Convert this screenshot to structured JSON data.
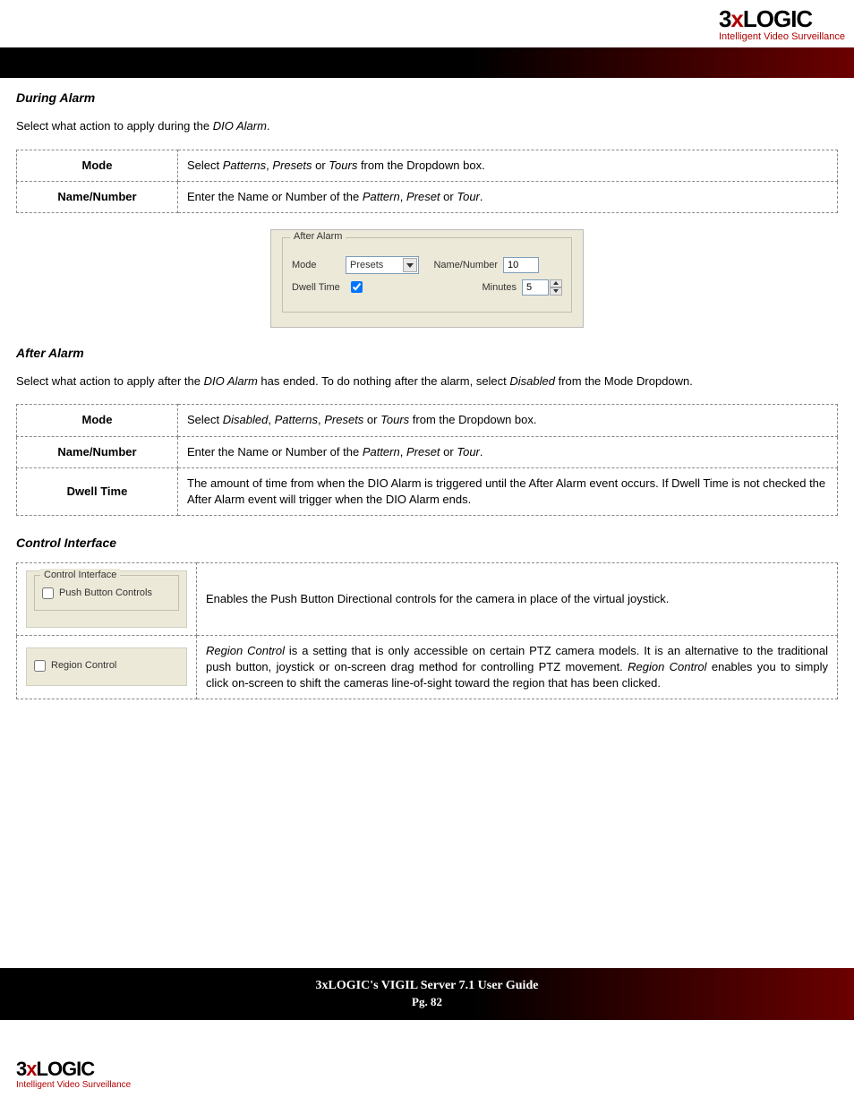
{
  "logo": {
    "text_prefix": "3",
    "text_mid": "x",
    "text_suffix": "LOGIC",
    "tag": "Intelligent Video Surveillance"
  },
  "sections": {
    "during_alarm": {
      "title": "During Alarm",
      "intro_pre": "Select what action to apply during the ",
      "intro_ital": "DIO Alarm",
      "intro_post": ".",
      "rows": {
        "mode_label": "Mode",
        "mode_desc_pre": "Select ",
        "mode_desc_i1": "Patterns",
        "mode_desc_m1": ", ",
        "mode_desc_i2": "Presets",
        "mode_desc_m2": " or ",
        "mode_desc_i3": "Tours",
        "mode_desc_post": " from the Dropdown box.",
        "nn_label": "Name/Number",
        "nn_desc_pre": "Enter the Name or Number of the ",
        "nn_desc_i1": "Pattern",
        "nn_desc_m1": ", ",
        "nn_desc_i2": "Preset",
        "nn_desc_m2": " or ",
        "nn_desc_i3": "Tour",
        "nn_desc_post": "."
      }
    },
    "mock": {
      "fieldset_title": "After Alarm",
      "mode_label": "Mode",
      "mode_value": "Presets",
      "nn_label": "Name/Number",
      "nn_value": "10",
      "dwell_label": "Dwell Time",
      "dwell_checked": true,
      "minutes_label": "Minutes",
      "minutes_value": "5"
    },
    "after_alarm": {
      "title": "After Alarm",
      "intro_pre": "Select what action to apply after the ",
      "intro_i1": "DIO Alarm",
      "intro_m1": " has ended.  To do nothing after the alarm, select ",
      "intro_i2": "Disabled",
      "intro_post": " from the Mode Dropdown.",
      "rows": {
        "mode_label": "Mode",
        "mode_desc_pre": "Select ",
        "mode_desc_i1": "Disabled",
        "mode_desc_m1": ", ",
        "mode_desc_i2": "Patterns",
        "mode_desc_m2": ", ",
        "mode_desc_i3": "Presets",
        "mode_desc_m3": " or ",
        "mode_desc_i4": "Tours",
        "mode_desc_post": " from the Dropdown box.",
        "nn_label": "Name/Number",
        "nn_desc_pre": "Enter the Name or Number of the ",
        "nn_desc_i1": "Pattern",
        "nn_desc_m1": ", ",
        "nn_desc_i2": "Preset",
        "nn_desc_m2": " or ",
        "nn_desc_i3": "Tour",
        "nn_desc_post": ".",
        "dwell_label": "Dwell Time",
        "dwell_desc": "The amount of time from when the DIO Alarm is triggered until the After Alarm event occurs.  If Dwell Time is not checked the After Alarm event will trigger when the DIO Alarm ends."
      }
    },
    "control_interface": {
      "title": "Control Interface",
      "row1_fieldset_title": "Control Interface",
      "row1_checkbox_label": "Push Button Controls",
      "row1_desc": "Enables the Push Button Directional controls for the camera in place of the virtual joystick.",
      "row2_checkbox_label": "Region Control",
      "row2_desc_i1": "Region Control",
      "row2_desc_m1": " is a setting that is only accessible on certain PTZ camera models. It is an alternative to the traditional push button, joystick or on-screen drag method for controlling PTZ movement. ",
      "row2_desc_i2": "Region Control",
      "row2_desc_post": " enables you to simply click on-screen to shift the cameras line-of-sight toward the region that has been clicked."
    }
  },
  "footer": {
    "title": "3xLOGIC's VIGIL Server 7.1 User Guide",
    "page": "Pg. 82"
  }
}
